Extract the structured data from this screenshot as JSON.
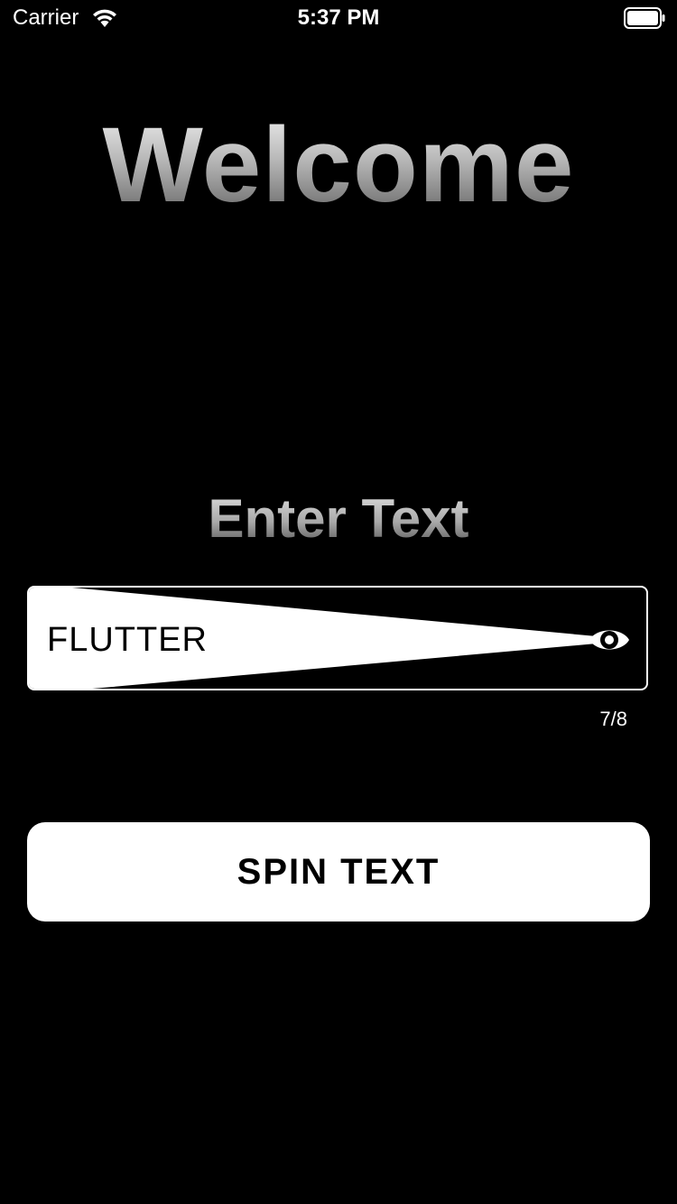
{
  "status_bar": {
    "carrier": "Carrier",
    "time": "5:37 PM",
    "icons": [
      "wifi-icon",
      "battery-icon"
    ]
  },
  "heading": {
    "title": "Welcome"
  },
  "input_section": {
    "label": "Enter Text",
    "value": "FLUTTER",
    "counter": "7/8",
    "icon": "eye-icon"
  },
  "actions": {
    "spin_label": "SPIN TEXT"
  },
  "colors": {
    "background": "#000000",
    "foreground": "#ffffff",
    "button_text": "#000000"
  }
}
